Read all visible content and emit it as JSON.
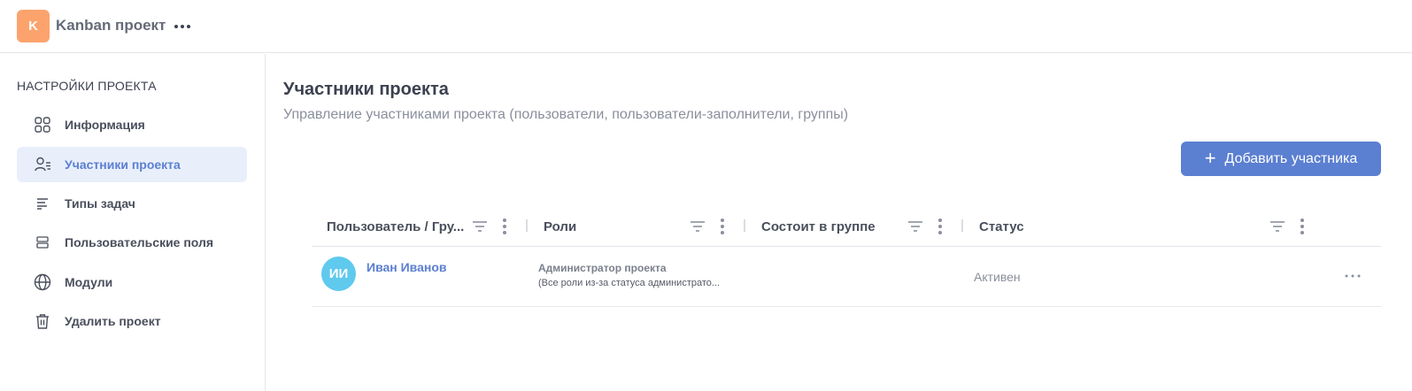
{
  "header": {
    "project_initial": "K",
    "project_name": "Kanban проект",
    "more_icon": "more-horizontal-icon",
    "accent_color": "#fca36d"
  },
  "sidebar": {
    "heading": "НАСТРОЙКИ ПРОЕКТА",
    "items": [
      {
        "label": "Информация",
        "icon": "grid-icon",
        "active": false
      },
      {
        "label": "Участники проекта",
        "icon": "users-list-icon",
        "active": true
      },
      {
        "label": "Типы задач",
        "icon": "task-lines-icon",
        "active": false
      },
      {
        "label": "Пользовательские поля",
        "icon": "fields-icon",
        "active": false
      },
      {
        "label": "Модули",
        "icon": "globe-icon",
        "active": false
      },
      {
        "label": "Удалить проект",
        "icon": "trash-icon",
        "active": false
      }
    ]
  },
  "main": {
    "title": "Участники проекта",
    "subtitle": "Управление участниками проекта (пользователи, пользователи-заполнители, группы)",
    "add_button_label": "Добавить участника",
    "primary_color": "#5b7fd1",
    "table": {
      "columns": [
        {
          "label": "Пользователь / Гру..."
        },
        {
          "label": "Роли"
        },
        {
          "label": "Состоит в группе"
        },
        {
          "label": "Статус"
        }
      ],
      "rows": [
        {
          "initials": "ИИ",
          "name": "Иван Иванов",
          "role_title": "Администратор проекта",
          "role_desc": "(Все роли из-за статуса администрато...",
          "group": "",
          "status": "Активен"
        }
      ]
    }
  }
}
